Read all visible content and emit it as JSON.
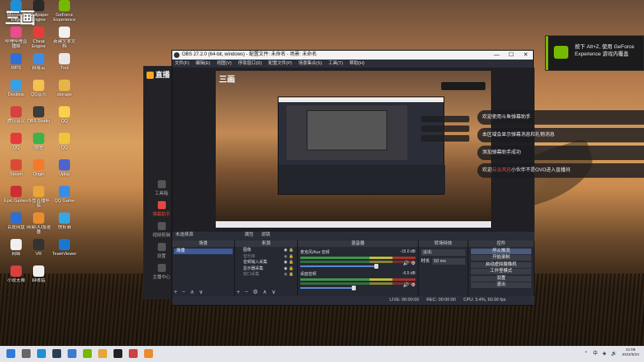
{
  "desktop": {
    "logo": "三画",
    "icons": [
      {
        "label": "Microsoft Edge",
        "color": "#1f8fd6"
      },
      {
        "label": "Wallpaper Engine",
        "color": "#2a2a2a"
      },
      {
        "label": "GeForce Experience",
        "color": "#76b900"
      },
      {
        "label": "哔哩哔哩直播姬",
        "color": "#e94c8f"
      },
      {
        "label": "Cheat Engine",
        "color": "#ea3b3b"
      },
      {
        "label": "新建文本文档",
        "color": "#f0f0f0"
      },
      {
        "label": "WPS",
        "color": "#2f6fd6"
      },
      {
        "label": "网易云",
        "color": "#3a8ee6"
      },
      {
        "label": "Tool",
        "color": "#e8e8e8"
      },
      {
        "label": "Desktop",
        "color": "#3aa0e0"
      },
      {
        "label": "QQ音乐",
        "color": "#f2c14e"
      },
      {
        "label": "storage",
        "color": "#e6b54a"
      },
      {
        "label": "腾讯会议",
        "color": "#d64141"
      },
      {
        "label": "OBS Studio",
        "color": "#3c3c3c"
      },
      {
        "label": "QQ",
        "color": "#f9d14a"
      },
      {
        "label": "QQ",
        "color": "#e63b3b"
      },
      {
        "label": "微信",
        "color": "#3bb34a"
      },
      {
        "label": "QQ",
        "color": "#f0c53c"
      },
      {
        "label": "Steam",
        "color": "#d84b34"
      },
      {
        "label": "Origin",
        "color": "#f27a2a"
      },
      {
        "label": "Uplay",
        "color": "#4f63cc"
      },
      {
        "label": "Epic Games",
        "color": "#cc2f2f"
      },
      {
        "label": "斗鱼直播伴侣",
        "color": "#e8a53a"
      },
      {
        "label": "QQ Game",
        "color": "#3b8de0"
      },
      {
        "label": "百度网盘",
        "color": "#2e6fd0"
      },
      {
        "label": "网易UU加速器",
        "color": "#e88c2e"
      },
      {
        "label": "快剪辑",
        "color": "#38a6e0"
      },
      {
        "label": "网络",
        "color": "#f0f0f0"
      },
      {
        "label": "VR",
        "color": "#333333"
      },
      {
        "label": "TeamViewer",
        "color": "#1b76d1"
      },
      {
        "label": "小说无限",
        "color": "#d84040"
      },
      {
        "label": "回收站",
        "color": "#eeeeee"
      }
    ]
  },
  "streamer_app": {
    "brand": "直播",
    "nav": [
      {
        "label": "工具箱",
        "active": false
      },
      {
        "label": "弹幕助手",
        "active": true
      },
      {
        "label": "视频剪辑",
        "active": false
      },
      {
        "label": "设置",
        "active": false
      },
      {
        "label": "主播中心",
        "active": false
      }
    ]
  },
  "obs": {
    "title": "OBS 27.2.0 (64-bit, windows) - 配置文件: 未命名 - 场景: 未命名",
    "window_controls": [
      "—",
      "☐",
      "✕"
    ],
    "menu": [
      "文件(F)",
      "编辑(E)",
      "视图(V)",
      "停靠窗口(D)",
      "配置文件(P)",
      "场景集合(S)",
      "工具(T)",
      "帮助(H)"
    ],
    "scene_bar": {
      "left": "未选择源",
      "props": "属性",
      "filters": "滤镜"
    },
    "docks": {
      "scenes": {
        "header": "场景",
        "items": [
          "场景"
        ]
      },
      "sources": {
        "header": "来源",
        "items": [
          {
            "label": "图像",
            "dim": false
          },
          {
            "label": "音乐库",
            "dim": true
          },
          {
            "label": "音频输入采集",
            "dim": false
          },
          {
            "label": "显示器采集",
            "dim": false
          },
          {
            "label": "窗口采集",
            "dim": true
          }
        ]
      },
      "mixer": {
        "header": "混音器",
        "channels": [
          {
            "name": "麦克风/Aux 音频",
            "db": "-15.0 dB",
            "level": 0.78
          },
          {
            "name": "桌面音频",
            "db": "-6.5 dB",
            "level": 0.55
          }
        ]
      },
      "transitions": {
        "header": "转场特效",
        "type": "淡出",
        "duration_label": "时长",
        "duration": "50 ms"
      },
      "controls": {
        "header": "控件",
        "buttons": [
          "停止推流",
          "开始录制",
          "启动虚拟摄像机",
          "工作室模式",
          "设置",
          "退出"
        ]
      }
    },
    "tools": [
      "+",
      "−",
      "⚙",
      "∧",
      "∨"
    ],
    "status": {
      "live": "LIVE: 00:00:00",
      "rec": "REC: 00:00:00",
      "cpu": "CPU: 3.4%, 60.00 fps"
    }
  },
  "nvidia_toast": {
    "text": "按下 Alt+Z, 使用 GeForce Experience 游戏内覆盖"
  },
  "toasts": [
    {
      "pre": "欢迎使用斗鱼弹幕助手",
      "red": "",
      "post": ""
    },
    {
      "pre": "本区域会显示弹幕消息和礼物消息",
      "red": "",
      "post": ""
    },
    {
      "pre": "添加弹幕助手成功",
      "red": "",
      "post": ""
    },
    {
      "pre": "欢迎",
      "red": "云淡风轻",
      "post": "小伙伴不是OVO进入直播间"
    }
  ],
  "taskbar": {
    "apps": [
      {
        "name": "start",
        "color": "#2f7bd8"
      },
      {
        "name": "search",
        "color": "#666666"
      },
      {
        "name": "edge",
        "color": "#1f8fd6"
      },
      {
        "name": "steam",
        "color": "#2a3d55"
      },
      {
        "name": "store",
        "color": "#3a7bd0"
      },
      {
        "name": "nvidia",
        "color": "#76b900"
      },
      {
        "name": "douyu",
        "color": "#e8a53a"
      },
      {
        "name": "obs",
        "color": "#222222"
      },
      {
        "name": "camera",
        "color": "#d04040"
      },
      {
        "name": "notes",
        "color": "#e88c2e"
      }
    ],
    "tray": [
      "⌃",
      "中",
      "◈",
      "🔊"
    ],
    "time": "21:08",
    "date": "2022/5/22"
  }
}
